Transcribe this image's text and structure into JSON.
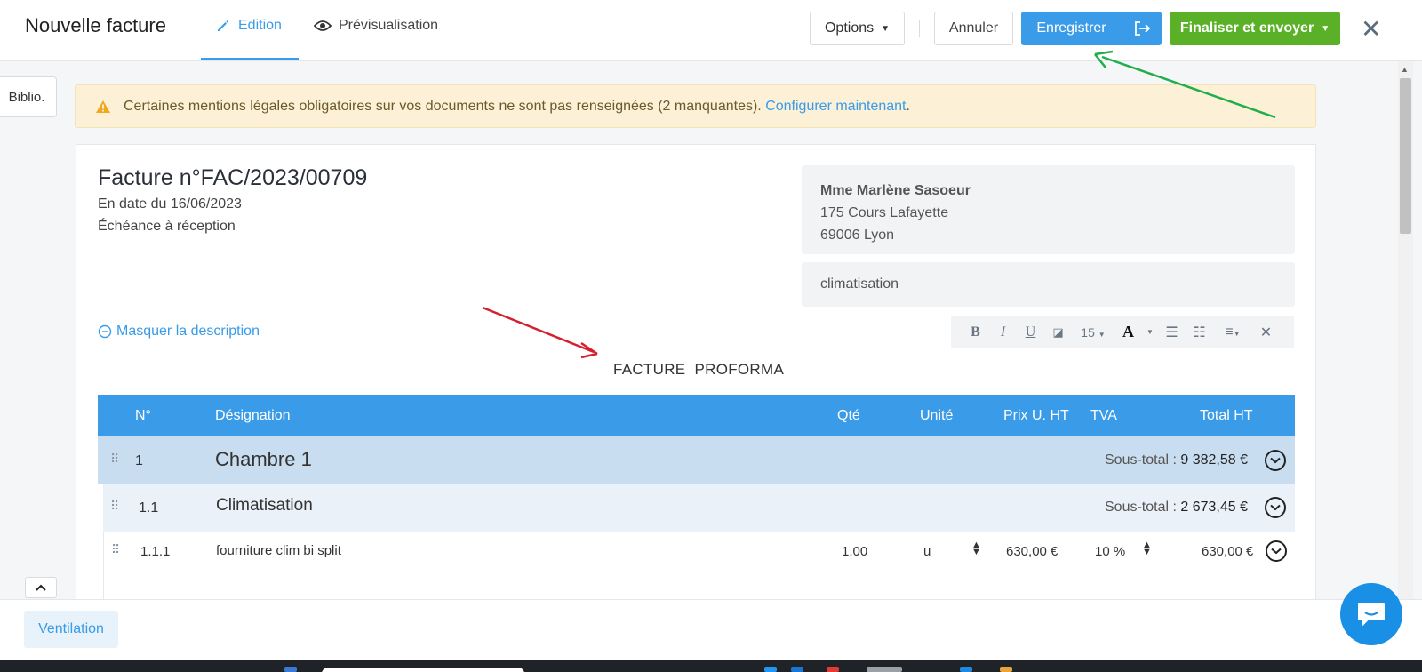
{
  "header": {
    "title": "Nouvelle facture",
    "tab_edit": "Edition",
    "tab_preview": "Prévisualisation",
    "options": "Options",
    "cancel": "Annuler",
    "save": "Enregistrer",
    "finalize": "Finaliser et envoyer"
  },
  "sidebar": {
    "biblio": "Biblio."
  },
  "warning": {
    "text": "Certaines mentions légales obligatoires sur vos documents ne sont pas renseignées (2 manquantes).",
    "link": "Configurer maintenant",
    "suffix": "."
  },
  "invoice": {
    "title": "Facture n°FAC/2023/00709",
    "date": "En date du 16/06/2023",
    "due": "Échéance à réception"
  },
  "client": {
    "name": "Mme Marlène Sasoeur",
    "address": "175 Cours Lafayette",
    "city": "69006 Lyon"
  },
  "object": "climatisation",
  "description": {
    "toggle": "Masquer la description",
    "text": "FACTURE  PROFORMA",
    "font_size": "15"
  },
  "table": {
    "headers": {
      "num": "N°",
      "designation": "Désignation",
      "qty": "Qté",
      "unit": "Unité",
      "price": "Prix U. HT",
      "vat": "TVA",
      "total": "Total HT"
    },
    "rows": [
      {
        "num": "1",
        "designation": "Chambre 1",
        "subtotal_label": "Sous-total :",
        "subtotal": "9 382,58 €"
      },
      {
        "num": "1.1",
        "designation": "Climatisation",
        "subtotal_label": "Sous-total :",
        "subtotal": "2 673,45 €"
      },
      {
        "num": "1.1.1",
        "designation": "fourniture clim bi split",
        "qty": "1,00",
        "unit": "u",
        "price": "630,00 €",
        "vat": "10 %",
        "total": "630,00 €"
      }
    ]
  },
  "footer": {
    "ventilation": "Ventilation"
  },
  "colors": {
    "primary": "#3a9be8",
    "success": "#5ab127",
    "warning_bg": "#fcf1d6"
  }
}
